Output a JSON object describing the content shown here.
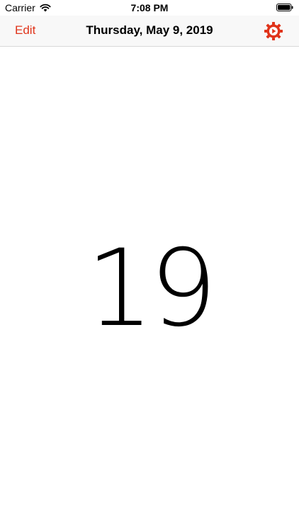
{
  "status_bar": {
    "carrier": "Carrier",
    "time": "7:08 PM",
    "wifi_icon": "wifi-icon",
    "battery_icon": "battery-icon"
  },
  "nav_bar": {
    "edit_label": "Edit",
    "title": "Thursday, May 9, 2019",
    "settings_icon": "gear-icon"
  },
  "main": {
    "day_number": "19"
  },
  "colors": {
    "accent": "#e0341b",
    "nav_background": "#f8f8f8",
    "text": "#000000"
  }
}
